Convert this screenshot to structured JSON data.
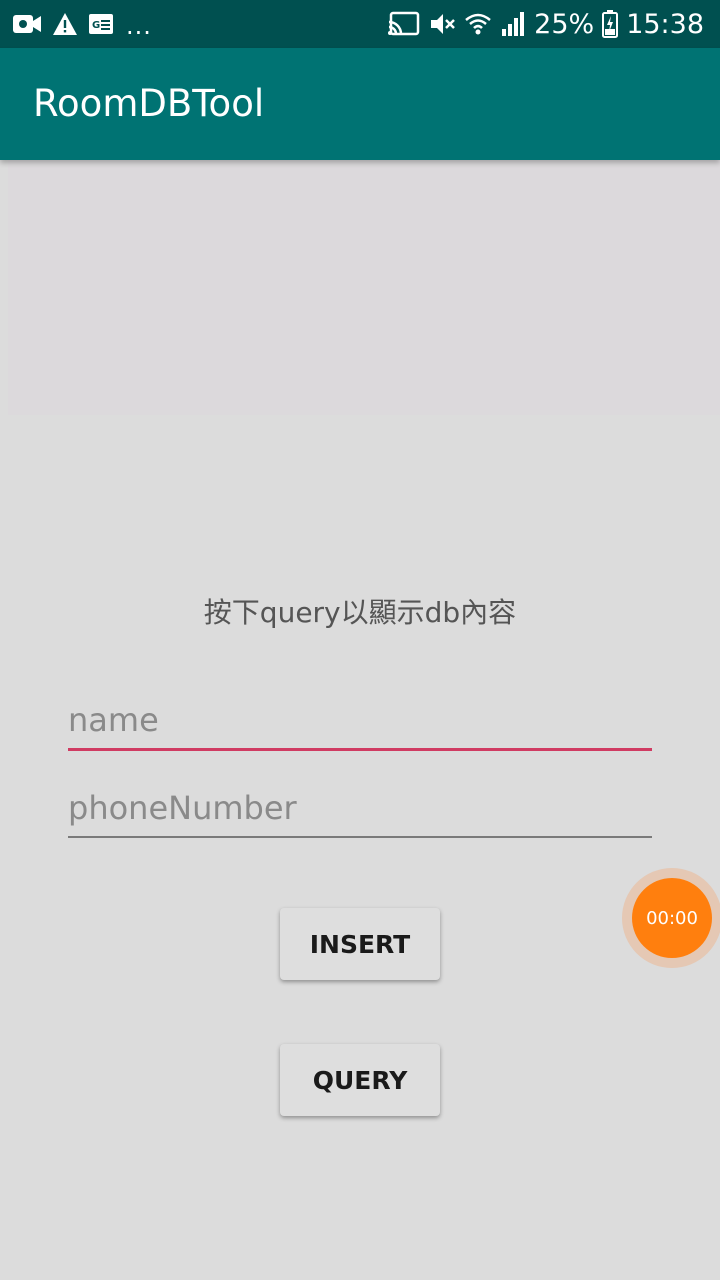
{
  "status_bar": {
    "left_icons": [
      "video-camera-icon",
      "warning-icon",
      "ge-news-icon"
    ],
    "overflow": "...",
    "right_icons": [
      "cast-icon",
      "mute-icon",
      "wifi-icon",
      "signal-icon"
    ],
    "battery_percent": "25%",
    "time": "15:38"
  },
  "app_bar": {
    "title": "RoomDBTool"
  },
  "main": {
    "hint": "按下query以顯示db內容",
    "name_placeholder": "name",
    "phone_placeholder": "phoneNumber",
    "insert_label": "INSERT",
    "query_label": "QUERY"
  },
  "overlay": {
    "timer": "00:00"
  },
  "colors": {
    "status_bar": "#005050",
    "app_bar": "#007373",
    "accent": "#d03b62",
    "timer": "#ff7f0e",
    "background": "#dcdcdc"
  }
}
